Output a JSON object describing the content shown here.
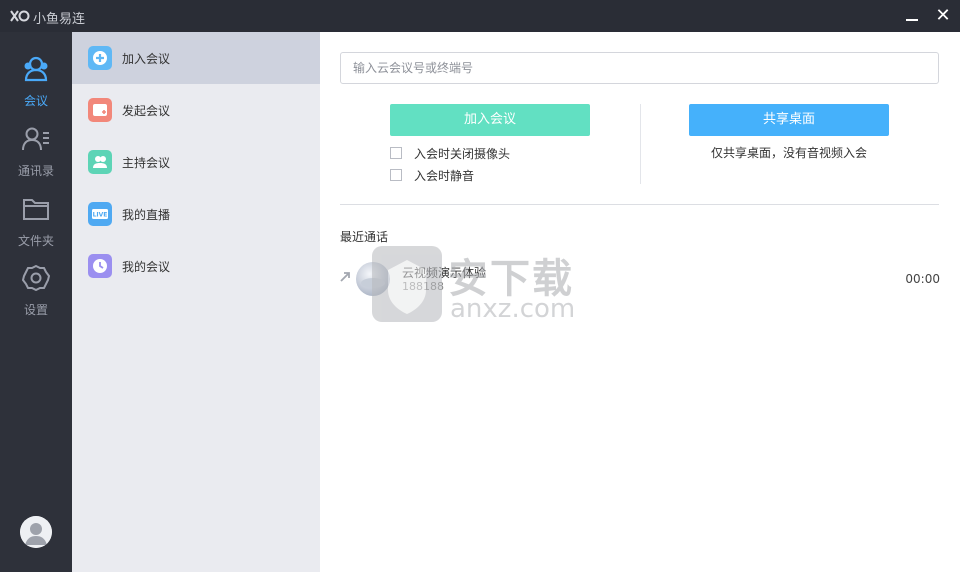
{
  "window": {
    "title": "小鱼易连"
  },
  "titlebar": {
    "minimize_icon": "minimize-icon",
    "close_glyph": "✕"
  },
  "nav": {
    "items": [
      {
        "label": "会议",
        "icon": "meeting-icon",
        "active": true
      },
      {
        "label": "通讯录",
        "icon": "contacts-icon",
        "active": false
      },
      {
        "label": "文件夹",
        "icon": "folder-icon",
        "active": false
      },
      {
        "label": "设置",
        "icon": "settings-icon",
        "active": false
      }
    ],
    "avatar_icon": "user-avatar-icon"
  },
  "submenu": {
    "items": [
      {
        "label": "加入会议",
        "icon": "plus-circle-icon",
        "color": "#5fb8f5",
        "active": true
      },
      {
        "label": "发起会议",
        "icon": "start-meeting-icon",
        "color": "#f2877a",
        "active": false
      },
      {
        "label": "主持会议",
        "icon": "host-icon",
        "color": "#5dd4b6",
        "active": false
      },
      {
        "label": "我的直播",
        "icon": "live-icon",
        "color": "#4fa9f2",
        "active": false
      },
      {
        "label": "我的会议",
        "icon": "clock-icon",
        "color": "#9b8ff0",
        "active": false
      }
    ]
  },
  "main": {
    "search_placeholder": "输入云会议号或终端号",
    "join_button": "加入会议",
    "share_button": "共享桌面",
    "options": [
      {
        "label": "入会时关闭摄像头",
        "checked": false
      },
      {
        "label": "入会时静音",
        "checked": false
      }
    ],
    "share_note": "仅共享桌面，没有音视频入会",
    "recent_title": "最近通话",
    "recent_calls": [
      {
        "name": "云视频演示体验",
        "number": "188188",
        "time": "00:00",
        "direction_icon": "outgoing-arrow-icon"
      }
    ]
  },
  "watermark": {
    "cn": "安下载",
    "en": "anxz.com"
  },
  "colors": {
    "titlebar": "#2a2d36",
    "rail": "#2e313a",
    "accent": "#4aa9f8",
    "join": "#62e0c2",
    "share": "#45b1fb"
  }
}
